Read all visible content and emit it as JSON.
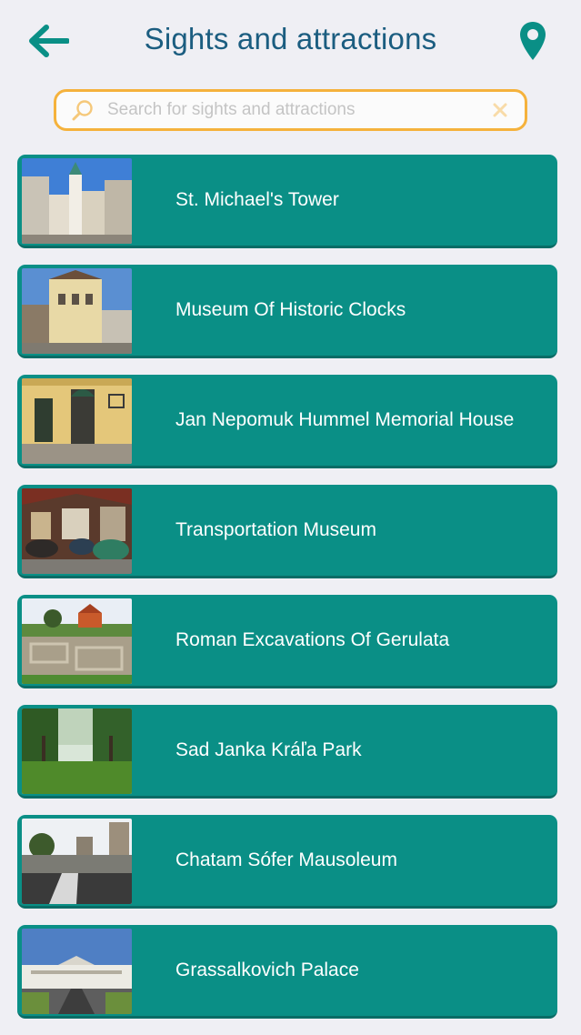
{
  "header": {
    "title": "Sights and attractions",
    "back_icon": "arrow-left-icon",
    "map_icon": "map-pin-icon",
    "accent_color": "#0a8f86",
    "title_color": "#1b5d80"
  },
  "search": {
    "placeholder": "Search for sights and attractions",
    "value": "",
    "border_color": "#f5b23c"
  },
  "attractions": [
    {
      "label": "St. Michael's Tower"
    },
    {
      "label": "Museum Of Historic Clocks"
    },
    {
      "label": "Jan Nepomuk Hummel Memorial House"
    },
    {
      "label": "Transportation Museum"
    },
    {
      "label": "Roman Excavations Of Gerulata"
    },
    {
      "label": "Sad Janka Kráľa Park"
    },
    {
      "label": "Chatam Sófer Mausoleum"
    },
    {
      "label": "Grassalkovich Palace"
    }
  ]
}
